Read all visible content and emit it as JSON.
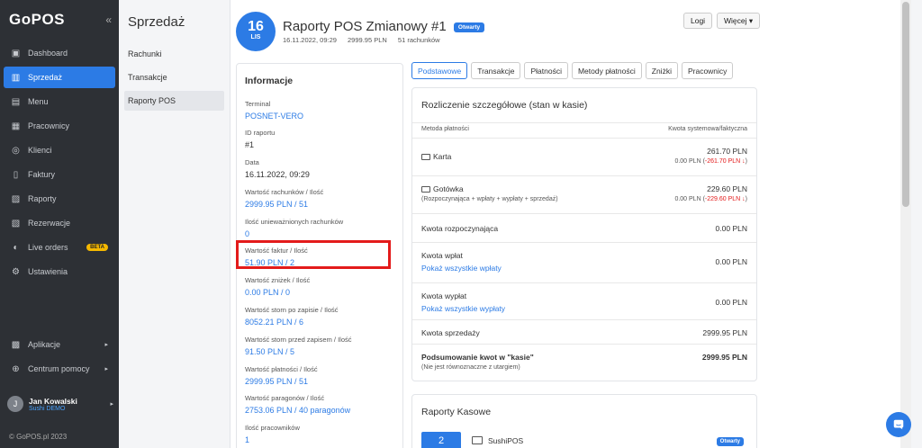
{
  "sidebar": {
    "logo": "GoPOS",
    "collapse": "«",
    "items": [
      {
        "label": "Dashboard",
        "icon": "▣"
      },
      {
        "label": "Sprzedaż",
        "icon": "▥"
      },
      {
        "label": "Menu",
        "icon": "▤"
      },
      {
        "label": "Pracownicy",
        "icon": "▦"
      },
      {
        "label": "Klienci",
        "icon": "◎"
      },
      {
        "label": "Faktury",
        "icon": "▯"
      },
      {
        "label": "Raporty",
        "icon": "▨"
      },
      {
        "label": "Rezerwacje",
        "icon": "▧"
      },
      {
        "label": "Live orders",
        "icon": "◐",
        "badge": "BETA"
      },
      {
        "label": "Ustawienia",
        "icon": "⚙"
      }
    ],
    "bottom": [
      {
        "label": "Aplikacje",
        "icon": "▩",
        "arrow": "▸"
      },
      {
        "label": "Centrum pomocy",
        "icon": "⊕",
        "arrow": "▸"
      }
    ],
    "user": {
      "initial": "J",
      "name": "Jan Kowalski",
      "org": "Sushi DEMO",
      "arrow": "▸"
    },
    "copyright": "© GoPOS.pl 2023"
  },
  "subnav": {
    "title": "Sprzedaż",
    "items": [
      "Rachunki",
      "Transakcje",
      "Raporty POS"
    ]
  },
  "header": {
    "day": "16",
    "month": "LIS",
    "title": "Raporty POS Zmianowy #1",
    "status": "Otwarty",
    "date": "16.11.2022, 09:29",
    "amount": "2999.95 PLN",
    "bills": "51 rachunków",
    "logs_btn": "Logi",
    "more_btn": "Więcej ▾"
  },
  "info": {
    "title": "Informacje",
    "fields": [
      {
        "label": "Terminal",
        "value": "POSNET-VERO"
      },
      {
        "label": "ID raportu",
        "value": "#1"
      },
      {
        "label": "Data",
        "value": "16.11.2022, 09:29"
      },
      {
        "label": "Wartość rachunków / Ilość",
        "value": "2999.95 PLN / 51"
      },
      {
        "label": "Ilość unieważnionych rachunków",
        "value": "0"
      },
      {
        "label": "Wartość faktur / Ilość",
        "value": "51.90 PLN / 2"
      },
      {
        "label": "Wartość zniżek / Ilość",
        "value": "0.00 PLN / 0"
      },
      {
        "label": "Wartość storn po zapisie / Ilość",
        "value": "8052.21 PLN / 6"
      },
      {
        "label": "Wartość storn przed zapisem / Ilość",
        "value": "91.50 PLN / 5"
      },
      {
        "label": "Wartość płatności / Ilość",
        "value": "2999.95 PLN / 51"
      },
      {
        "label": "Wartość paragonów / Ilość",
        "value": "2753.06 PLN / 40 paragonów"
      },
      {
        "label": "Ilość pracowników",
        "value": "1"
      }
    ]
  },
  "tabs": [
    "Podstawowe",
    "Transakcje",
    "Płatności",
    "Metody płatności",
    "Zniżki",
    "Pracownicy"
  ],
  "detail": {
    "title": "Rozliczenie szczegółowe (stan w kasie)",
    "col_left": "Metoda płatności",
    "col_right": "Kwota systemowa/faktyczna",
    "karta": {
      "label": "Karta",
      "value": "261.70 PLN",
      "sub_a": "0.00 PLN (",
      "sub_b": "-261.70 PLN ↓",
      "sub_c": ")"
    },
    "gotowka": {
      "label": "Gotówka",
      "sub": "(Rozpoczynająca + wpłaty + wypłaty + sprzedaż)",
      "value": "229.60 PLN",
      "sub_a": "0.00 PLN (",
      "sub_b": "-229.60 PLN ↓",
      "sub_c": ")"
    },
    "rozpoczynajaca": {
      "label": "Kwota rozpoczynająca",
      "value": "0.00 PLN"
    },
    "wplat": {
      "label": "Kwota wpłat",
      "link": "Pokaż wszystkie wpłaty",
      "value": "0.00 PLN"
    },
    "wyplat": {
      "label": "Kwota wypłat",
      "link": "Pokaż wszystkie wypłaty",
      "value": "0.00 PLN"
    },
    "sprzedazy": {
      "label": "Kwota sprzedaży",
      "value": "2999.95 PLN"
    },
    "podsumowanie": {
      "label": "Podsumowanie kwot w \"kasie\"",
      "sub": "(Nie jest równoznaczne z utargiem)",
      "value": "2999.95 PLN"
    }
  },
  "kasowe": {
    "title": "Raporty Kasowe",
    "count": "2",
    "pos_name": "SushiPOS",
    "status": "Otwarty"
  }
}
